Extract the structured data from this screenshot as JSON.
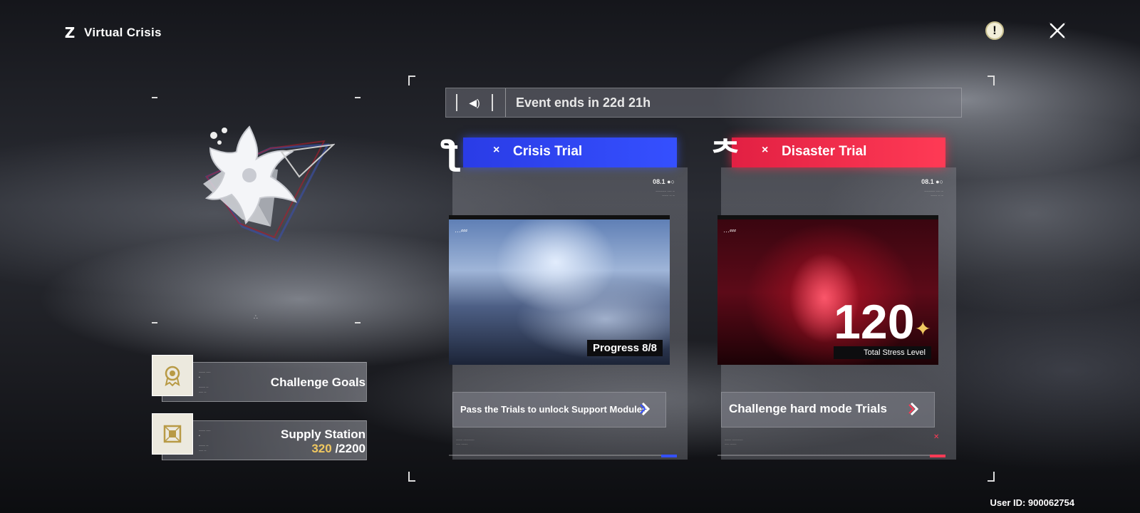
{
  "header": {
    "title": "Virtual Crisis",
    "logo_glyph": "Z"
  },
  "icons": {
    "info": "exclamation-icon",
    "close": "close-x-icon"
  },
  "side_buttons": {
    "challenge_goals": {
      "label": "Challenge Goals"
    },
    "supply_station": {
      "label": "Supply Station",
      "current": "320",
      "total": "/2200",
      "current_color": "#f0c860"
    }
  },
  "event": {
    "ends_text": "Event ends in 22d 21h"
  },
  "trials": {
    "crisis": {
      "title": "Crisis Trial",
      "x_mark": "×",
      "code": "08.1",
      "progress": "Progress 8/8",
      "cta": "Pass the Trials to unlock Support Modules",
      "accent": "#3550ff"
    },
    "disaster": {
      "title": "Disaster Trial",
      "x_mark": "×",
      "code": "08.1",
      "stress_value": "120",
      "stress_label": "Total Stress Level",
      "cta": "Challenge hard mode Trials",
      "accent": "#ff3a55"
    }
  },
  "footer": {
    "user_id": "User ID: 900062754"
  }
}
